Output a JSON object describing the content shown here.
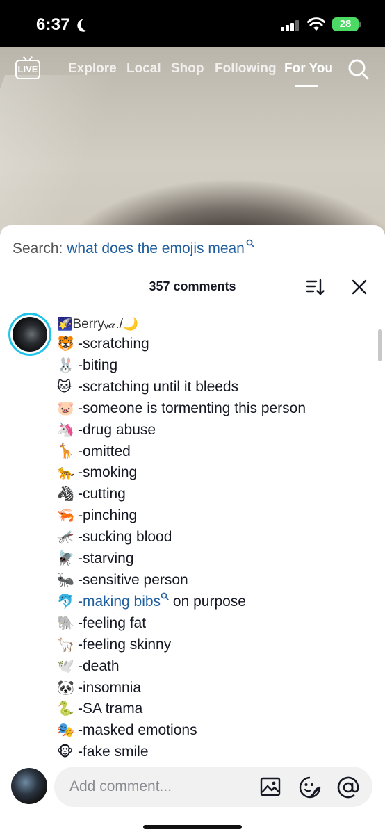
{
  "status_bar": {
    "time": "6:37",
    "battery": "28"
  },
  "top_nav": {
    "live_label": "LIVE",
    "tabs": [
      {
        "label": "Explore"
      },
      {
        "label": "Local"
      },
      {
        "label": "Shop"
      },
      {
        "label": "Following"
      },
      {
        "label": "For You",
        "active": true
      }
    ]
  },
  "search": {
    "label": "Search:",
    "query": "what does the emojis mean"
  },
  "comments_header": {
    "count_text": "357 comments"
  },
  "comment": {
    "username_prefix_emoji": "🌠",
    "username": "Berryᵥ𝒶./",
    "username_suffix_emoji": "🌙",
    "lines": [
      {
        "emoji": "🐯",
        "text": "-scratching"
      },
      {
        "emoji": "🐰",
        "text": "-biting"
      },
      {
        "emoji": "🐱",
        "text": "-scratching until it bleeds"
      },
      {
        "emoji": "🐷",
        "text": "-someone is tormenting this person"
      },
      {
        "emoji": "🦄",
        "text": "-drug abuse"
      },
      {
        "emoji": "🦒",
        "text": "-omitted"
      },
      {
        "emoji": "🐆",
        "text": "-smoking"
      },
      {
        "emoji": "🦓",
        "text": "-cutting"
      },
      {
        "emoji": "🦐",
        "text": "-pinching"
      },
      {
        "emoji": "🦟",
        "text": "-sucking blood"
      },
      {
        "emoji": "🪰",
        "text": "-starving"
      },
      {
        "emoji": "🐜",
        "text": "-sensitive person"
      },
      {
        "emoji": "🐬",
        "text_prefix": "-",
        "link": "making bibs",
        "text_suffix": " on purpose"
      },
      {
        "emoji": "🐘",
        "text": "-feeling fat"
      },
      {
        "emoji": "🦙",
        "text": "-feeling skinny"
      },
      {
        "emoji": "🕊️",
        "text": "-death"
      },
      {
        "emoji": "🐼",
        "text": "-insomnia"
      },
      {
        "emoji": "🐍",
        "text": "-SA trama"
      },
      {
        "emoji": "🎭",
        "text": "-masked emotions"
      },
      {
        "emoji": "🐵",
        "text": "-fake smile"
      }
    ]
  },
  "input_bar": {
    "placeholder": "Add comment..."
  },
  "icons": [
    "moon-icon",
    "signal-icon",
    "wifi-icon",
    "battery-icon",
    "live-icon",
    "search-icon",
    "sort-icon",
    "close-icon",
    "image-icon",
    "emoji-icon",
    "mention-icon"
  ],
  "colors": {
    "link": "#1f5f9e",
    "avatar_ring": "#20c4e8",
    "battery": "#4cd964"
  }
}
